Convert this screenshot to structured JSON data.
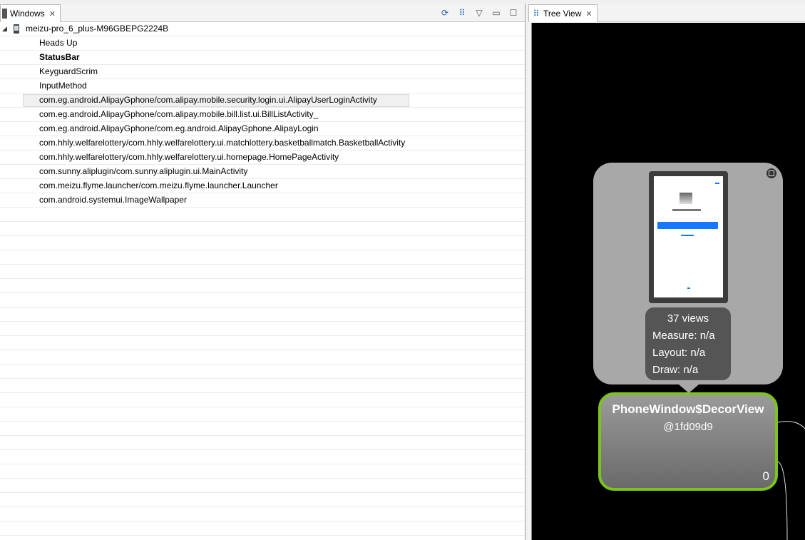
{
  "windows_view": {
    "tab_label": "Windows",
    "tab_close": "✕",
    "tools": {
      "refresh_icon": "⟳",
      "load_tree_icon": "⠿",
      "menu_icon": "▽",
      "minimize_icon": "▭",
      "maximize_icon": "☐"
    },
    "device": {
      "name": "meizu-pro_6_plus-M96GBEPG2224B",
      "expander": "◢"
    },
    "windows": [
      "Heads Up",
      "StatusBar",
      "KeyguardScrim",
      "InputMethod",
      "com.eg.android.AlipayGphone/com.alipay.mobile.security.login.ui.AlipayUserLoginActivity",
      "com.eg.android.AlipayGphone/com.alipay.mobile.bill.list.ui.BillListActivity_",
      "com.eg.android.AlipayGphone/com.eg.android.AlipayGphone.AlipayLogin",
      "com.hhly.welfarelottery/com.hhly.welfarelottery.ui.matchlottery.basketballmatch.BasketballActivity",
      "com.hhly.welfarelottery/com.hhly.welfarelottery.ui.homepage.HomePageActivity",
      "com.sunny.aliplugin/com.sunny.aliplugin.ui.MainActivity",
      "com.meizu.flyme.launcher/com.meizu.flyme.launcher.Launcher",
      "com.android.systemui.ImageWallpaper"
    ]
  },
  "tree_view": {
    "tab_label": "Tree View",
    "tab_close": "✕",
    "tab_icon": "⠿",
    "stats": {
      "views": "37 views",
      "measure": "Measure: n/a",
      "layout": "Layout: n/a",
      "draw": "Draw: n/a"
    },
    "node": {
      "title": "PhoneWindow$DecorView",
      "id": "@1fd09d9",
      "index": "0"
    }
  },
  "colors": {
    "node_border": "#7cc31d",
    "canvas_bg": "#000000",
    "accent": "#1a5fb4"
  }
}
